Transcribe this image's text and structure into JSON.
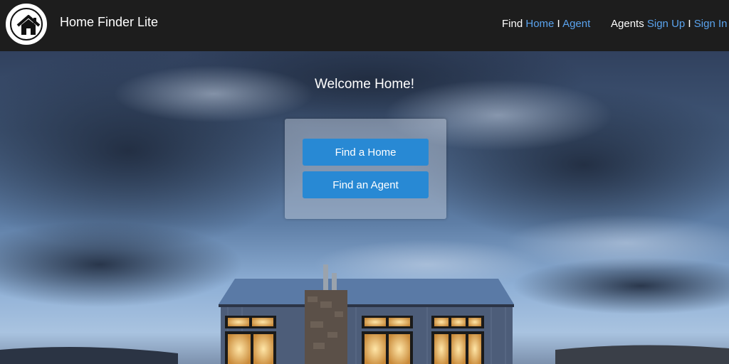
{
  "header": {
    "brand": "Home Finder Lite",
    "logo_icon": "house-icon",
    "nav_find": {
      "label": "Find",
      "home": "Home",
      "separator": "I",
      "agent": "Agent"
    },
    "nav_agents": {
      "label": "Agents",
      "sign_up": "Sign Up",
      "separator": "I",
      "sign_in": "Sign In"
    }
  },
  "hero": {
    "welcome": "Welcome Home!",
    "buttons": {
      "find_home": "Find a Home",
      "find_agent": "Find an Agent"
    }
  },
  "colors": {
    "header_bg": "#1d1d1d",
    "link": "#5aa3ee",
    "button": "#2889d4"
  }
}
